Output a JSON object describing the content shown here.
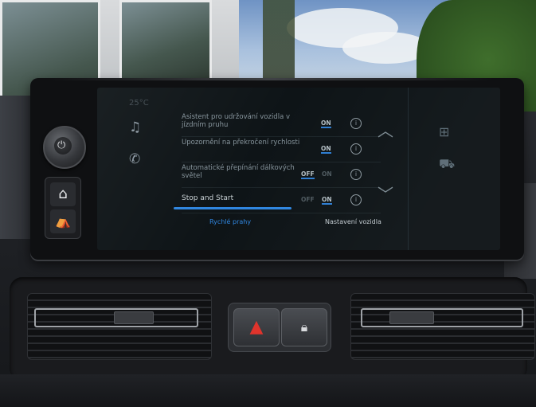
{
  "display": {
    "status_text": "25°C",
    "settings_rows": [
      {
        "label": "Asistent pro udržování vozidla v jízdním pruhu",
        "toggle_off": "",
        "toggle_on": "ON",
        "active": "on"
      },
      {
        "label": "Upozornění na překročení rychlosti",
        "toggle_off": "",
        "toggle_on": "ON",
        "active": "on"
      },
      {
        "label": "Automatické přepínání dálkových světel",
        "toggle_off": "OFF",
        "toggle_on": "ON",
        "active": "off"
      },
      {
        "label": "Stop and Start",
        "toggle_off": "OFF",
        "toggle_on": "ON",
        "active": "on"
      }
    ],
    "tabs": {
      "active": "Rychlé prahy",
      "inactive": "Nastavení vozidla"
    },
    "icons": {
      "music": "music-icon",
      "phone": "phone-icon",
      "apps": "apps-grid-icon",
      "car": "car-icon",
      "up": "chevron-up-icon",
      "down": "chevron-down-icon",
      "info": "info-icon"
    }
  },
  "controls": {
    "power_knob": "power-icon",
    "home": "home-icon",
    "seat": "seat-icon",
    "hazard": "hazard-icon",
    "lock": "lock-icon"
  },
  "colors": {
    "accent": "#2f86e0",
    "hazard": "#e0342c"
  }
}
